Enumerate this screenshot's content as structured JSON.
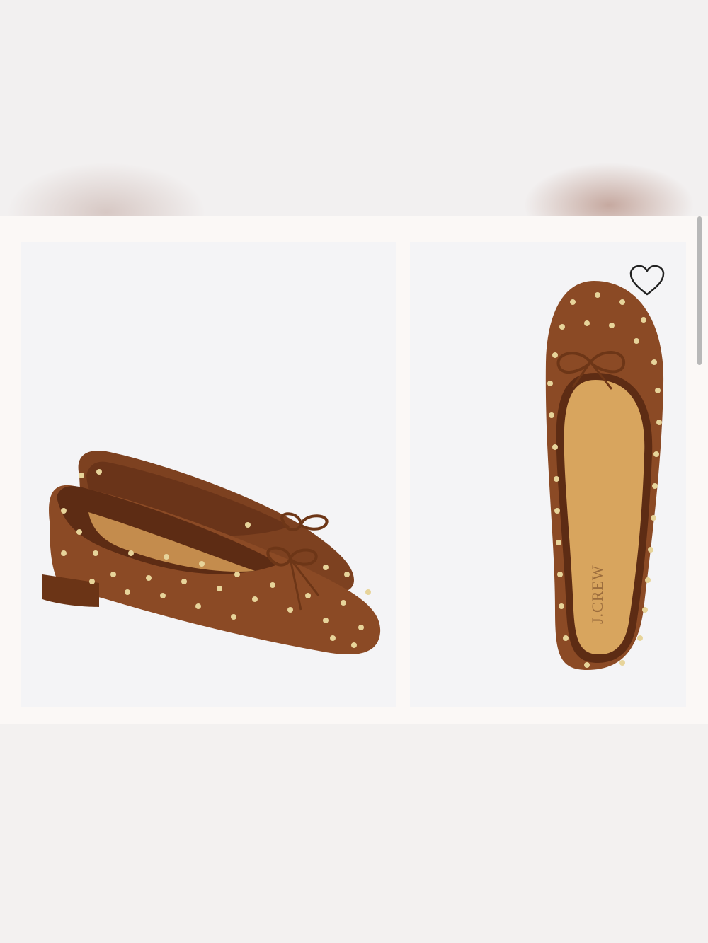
{
  "product": {
    "brand_on_insole": "J.CREW",
    "favorite_icon": "heart-outline-icon",
    "colors": {
      "suede": "#8b4a25",
      "stud": "#e7d49a",
      "insole": "#d8a55e",
      "tile_bg": "#f4f4f6"
    }
  }
}
